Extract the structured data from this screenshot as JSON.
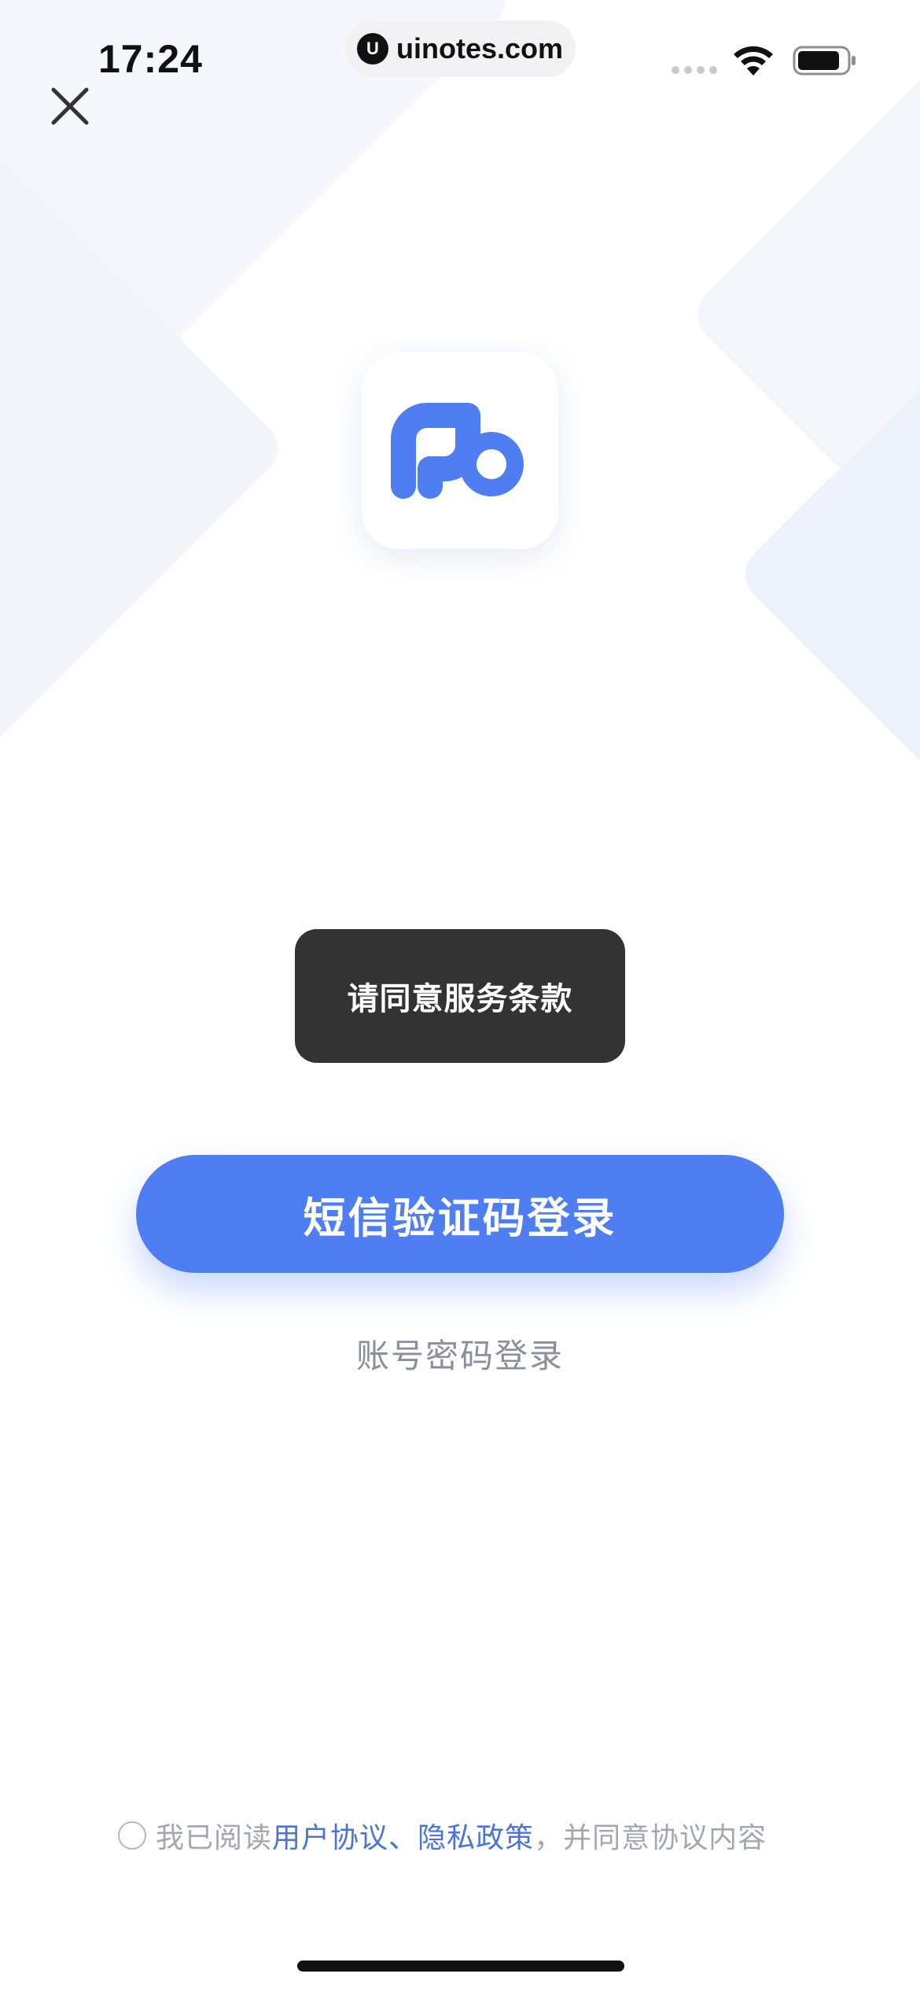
{
  "status_bar": {
    "time": "17:24",
    "url": "uinotes.com",
    "url_logo": "U",
    "icons": [
      "signal-icon",
      "wifi-icon",
      "battery-icon"
    ]
  },
  "header": {
    "close_icon": "close-icon"
  },
  "app_logo": {
    "icon": "fb-logo-icon",
    "color": "#4F7EF2"
  },
  "toast": {
    "message": "请同意服务条款"
  },
  "actions": {
    "sms_login": "短信验证码登录",
    "password_login": "账号密码登录"
  },
  "agreement": {
    "checked": false,
    "prefix": "我已阅读",
    "user_agreement": "用户协议",
    "separator": "、",
    "privacy_policy": "隐私政策",
    "suffix": "，并同意协议内容"
  },
  "colors": {
    "primary": "#4F7EF2",
    "link": "#4A74D6",
    "toast_bg": "#333333",
    "muted_text": "#8A8F9C"
  }
}
